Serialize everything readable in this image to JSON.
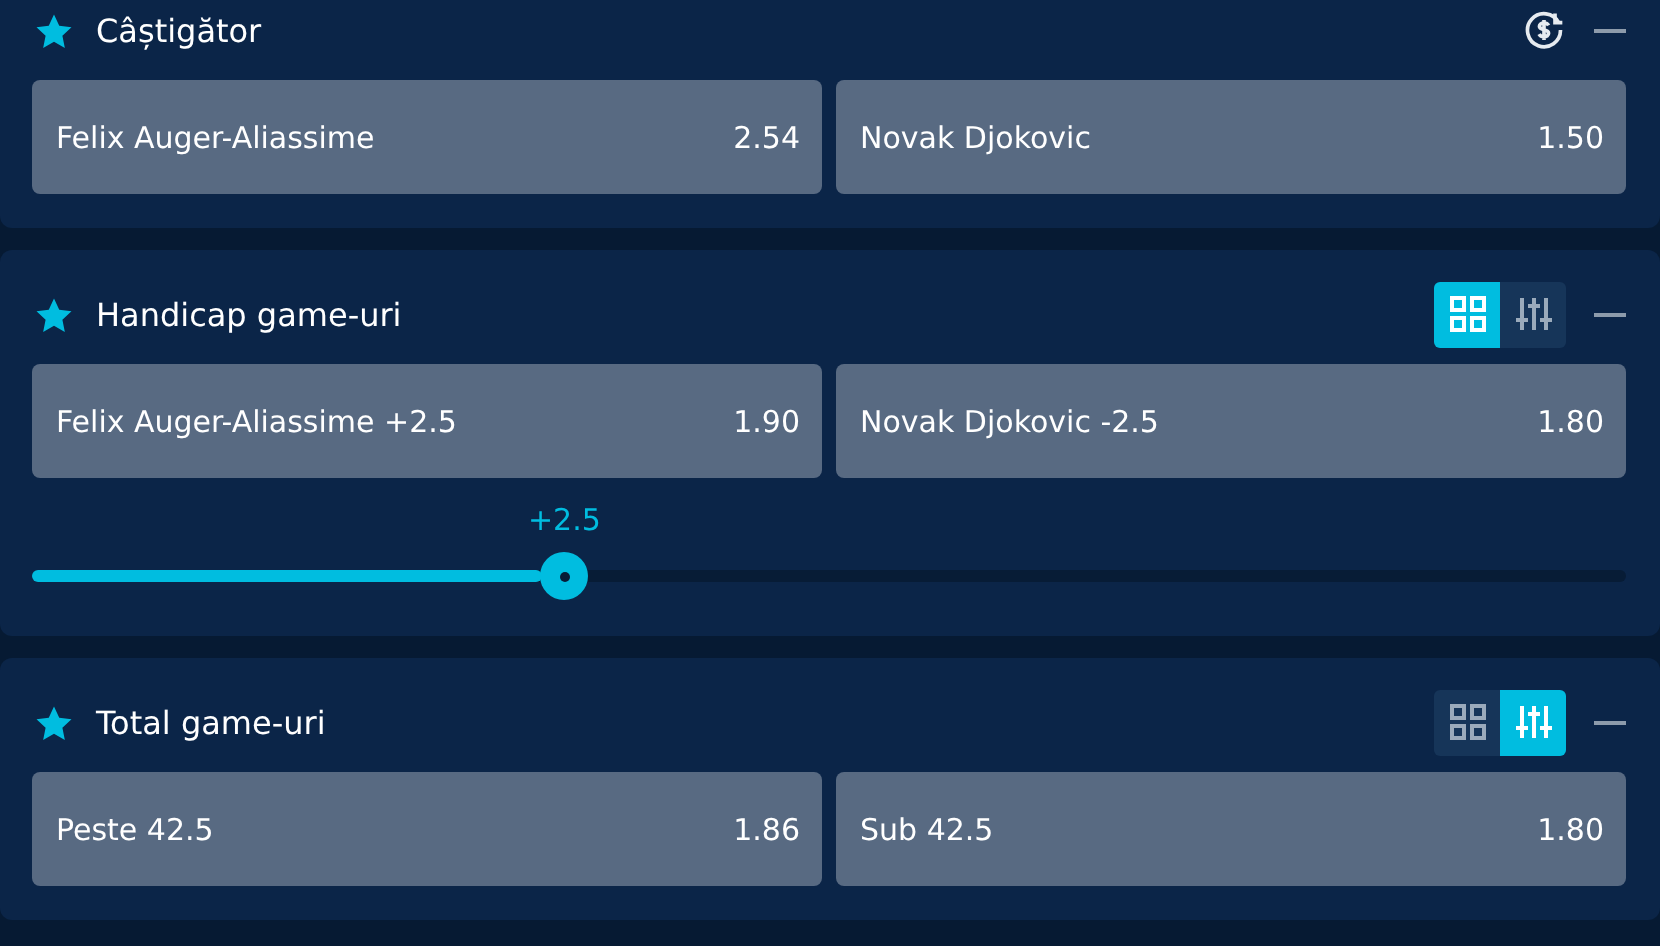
{
  "markets": [
    {
      "title": "Câștigător",
      "favorite": true,
      "tool": {
        "kind": "cashout"
      },
      "selections": [
        {
          "label": "Felix Auger-Aliassime",
          "odds": "2.54"
        },
        {
          "label": "Novak Djokovic",
          "odds": "1.50"
        }
      ]
    },
    {
      "title": "Handicap game-uri",
      "favorite": true,
      "tool": {
        "kind": "views",
        "options": [
          {
            "kind": "grid",
            "selected": true
          },
          {
            "kind": "slider",
            "selected": false
          }
        ]
      },
      "selections": [
        {
          "label": "Felix Auger-Aliassime +2.5",
          "odds": "1.90"
        },
        {
          "label": "Novak Djokovic -2.5",
          "odds": "1.80"
        }
      ],
      "slider": {
        "label": "+2.5",
        "level": 0.334
      }
    },
    {
      "title": "Total game-uri",
      "favorite": true,
      "tool": {
        "kind": "views",
        "options": [
          {
            "kind": "grid",
            "selected": false
          },
          {
            "kind": "slider",
            "selected": true
          }
        ]
      },
      "selections": [
        {
          "label": "Peste 42.5",
          "odds": "1.86"
        },
        {
          "label": "Sub 42.5",
          "odds": "1.80"
        }
      ]
    }
  ]
}
